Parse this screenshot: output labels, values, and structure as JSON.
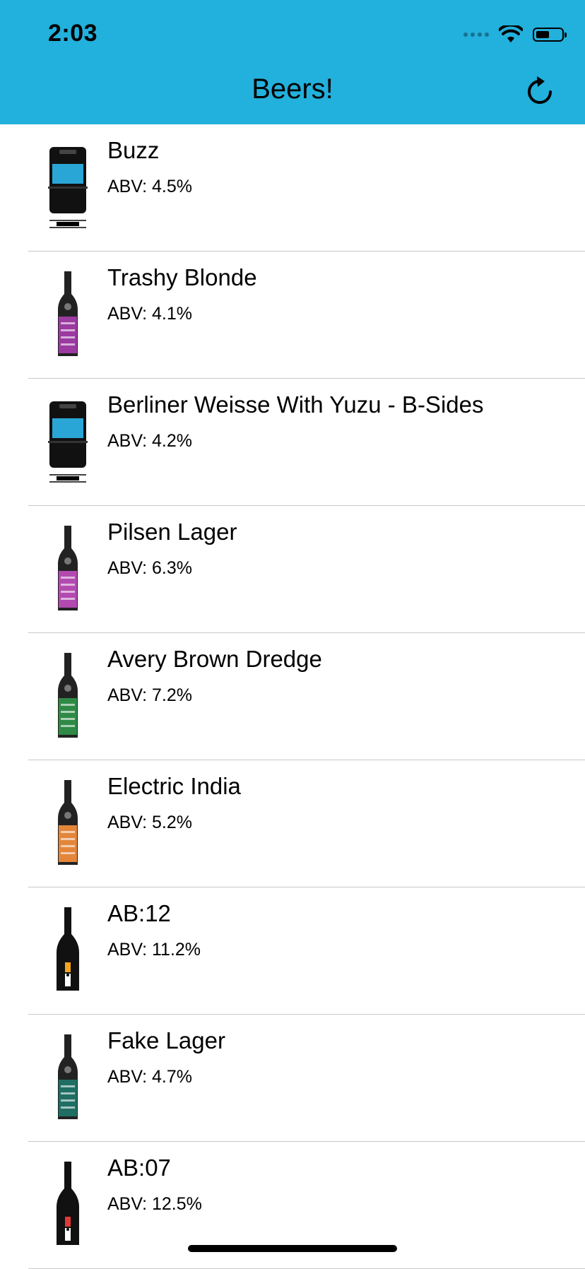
{
  "status_bar": {
    "time": "2:03"
  },
  "nav": {
    "title": "Beers!",
    "refresh_icon": "refresh-icon"
  },
  "beers": [
    {
      "name": "Buzz",
      "abv": "ABV: 4.5%",
      "image": "keg",
      "label_color": "#2aa6d6"
    },
    {
      "name": "Trashy Blonde",
      "abv": "ABV: 4.1%",
      "image": "bottle",
      "label_color": "#9b3aa0"
    },
    {
      "name": "Berliner Weisse With Yuzu - B-Sides",
      "abv": "ABV: 4.2%",
      "image": "keg",
      "label_color": "#2aa6d6"
    },
    {
      "name": "Pilsen Lager",
      "abv": "ABV: 6.3%",
      "image": "bottle",
      "label_color": "#b24ab0"
    },
    {
      "name": "Avery Brown Dredge",
      "abv": "ABV: 7.2%",
      "image": "bottle",
      "label_color": "#2e8a45"
    },
    {
      "name": "Electric India",
      "abv": "ABV: 5.2%",
      "image": "bottle",
      "label_color": "#e3863a"
    },
    {
      "name": "AB:12",
      "abv": "ABV: 11.2%",
      "image": "champagne",
      "label_color": "#f3a41f"
    },
    {
      "name": "Fake Lager",
      "abv": "ABV: 4.7%",
      "image": "bottle",
      "label_color": "#1f6e63"
    },
    {
      "name": "AB:07",
      "abv": "ABV: 12.5%",
      "image": "champagne",
      "label_color": "#e03a3a"
    }
  ]
}
